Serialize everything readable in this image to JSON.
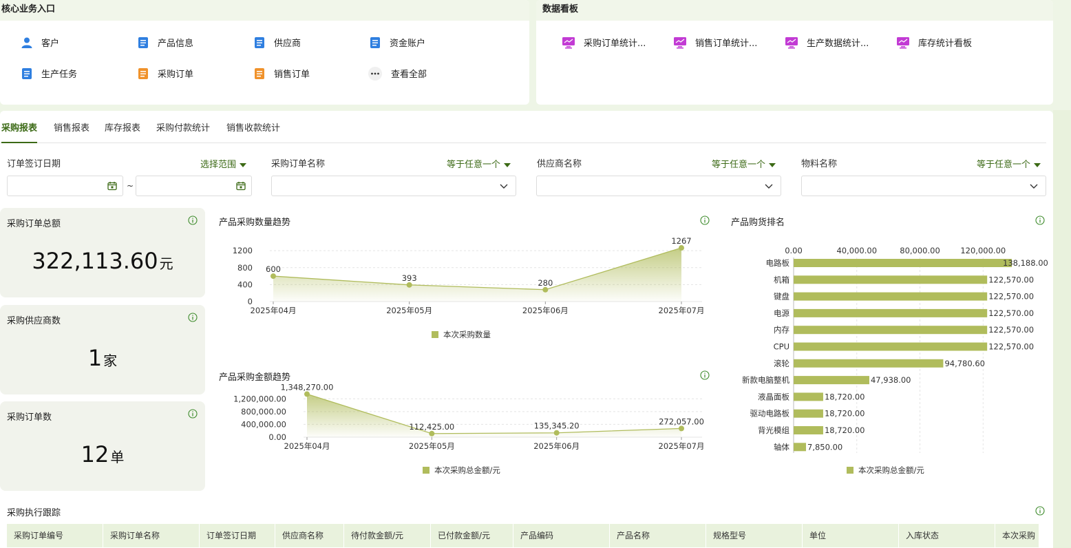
{
  "core": {
    "title": "核心业务入口",
    "items": [
      {
        "label": "客户",
        "icon": "user-icon"
      },
      {
        "label": "产品信息",
        "icon": "document-icon"
      },
      {
        "label": "供应商",
        "icon": "document-icon"
      },
      {
        "label": "资金账户",
        "icon": "document-icon"
      },
      {
        "label": "生产任务",
        "icon": "document-icon"
      },
      {
        "label": "采购订单",
        "icon": "document-icon"
      },
      {
        "label": "销售订单",
        "icon": "document-icon"
      },
      {
        "label": "查看全部",
        "icon": "more-icon"
      }
    ]
  },
  "dashboard": {
    "title": "数据看板",
    "items": [
      {
        "label": "采购订单统计..."
      },
      {
        "label": "销售订单统计..."
      },
      {
        "label": "生产数据统计..."
      },
      {
        "label": "库存统计看板"
      }
    ]
  },
  "tabs": [
    "采购报表",
    "销售报表",
    "库存报表",
    "采购付款统计",
    "销售收款统计"
  ],
  "filters": [
    {
      "label": "订单签订日期",
      "op": "选择范围"
    },
    {
      "label": "采购订单名称",
      "op": "等于任意一个"
    },
    {
      "label": "供应商名称",
      "op": "等于任意一个"
    },
    {
      "label": "物料名称",
      "op": "等于任意一个"
    }
  ],
  "date_sep": "~",
  "kpis": [
    {
      "title": "采购订单总额",
      "value": "322,113.60",
      "unit": "元"
    },
    {
      "title": "采购供应商数",
      "value": "1",
      "unit": "家"
    },
    {
      "title": "采购订单数",
      "value": "12",
      "unit": "单"
    }
  ],
  "colors": {
    "accent": "#3c6a16",
    "series": "#b0bc5c",
    "purple": "#c23bd4",
    "blue": "#2f7fe0",
    "orange": "#f0922b"
  },
  "chart_data": [
    {
      "type": "area",
      "title": "产品采购数量趋势",
      "categories": [
        "2025年04月",
        "2025年05月",
        "2025年06月",
        "2025年07月"
      ],
      "series": [
        {
          "name": "本次采购数量",
          "values": [
            600,
            393,
            280,
            1267
          ]
        }
      ],
      "yticks": [
        "0",
        "400",
        "800",
        "1200"
      ],
      "ylim": [
        0,
        1300
      ],
      "data_labels": [
        "600",
        "393",
        "280",
        "1267"
      ],
      "legend": "bottom"
    },
    {
      "type": "area",
      "title": "产品采购金额趋势",
      "categories": [
        "2025年04月",
        "2025年05月",
        "2025年06月",
        "2025年07月"
      ],
      "series": [
        {
          "name": "本次采购总金额/元",
          "values": [
            1348270.0,
            112425.0,
            135345.2,
            272057.0
          ]
        }
      ],
      "yticks": [
        "0.00",
        "400,000.00",
        "800,000.00",
        "1,200,000.00"
      ],
      "ylim": [
        0,
        1400000
      ],
      "data_labels": [
        "1,348,270.00",
        "112,425.00",
        "135,345.20",
        "272,057.00"
      ],
      "legend": "bottom"
    },
    {
      "type": "bar",
      "orientation": "horizontal",
      "title": "产品购货排名",
      "categories": [
        "电路板",
        "机箱",
        "键盘",
        "电源",
        "内存",
        "CPU",
        "滚轮",
        "新款电脑整机",
        "液晶面板",
        "驱动电路板",
        "背光模组",
        "轴体"
      ],
      "series": [
        {
          "name": "本次采购总金额/元",
          "values": [
            138188.0,
            122570.0,
            122570.0,
            122570.0,
            122570.0,
            122570.0,
            94780.6,
            47938.0,
            18720.0,
            18720.0,
            18720.0,
            7850.0
          ]
        }
      ],
      "xticks": [
        "0.00",
        "40,000.00",
        "80,000.00",
        "120,000.00"
      ],
      "xlim": [
        0,
        136000
      ],
      "data_labels": [
        "138,188.00",
        "122,570.00",
        "122,570.00",
        "122,570.00",
        "122,570.00",
        "122,570.00",
        "94,780.60",
        "47,938.00",
        "18,720.00",
        "18,720.00",
        "18,720.00",
        "7,850.00"
      ],
      "legend": "bottom"
    }
  ],
  "table": {
    "title": "采购执行跟踪",
    "columns": [
      "采购订单编号",
      "采购订单名称",
      "订单签订日期",
      "供应商名称",
      "待付款金额/元",
      "已付款金额/元",
      "产品编码",
      "产品名称",
      "规格型号",
      "单位",
      "入库状态",
      "本次采购"
    ]
  }
}
